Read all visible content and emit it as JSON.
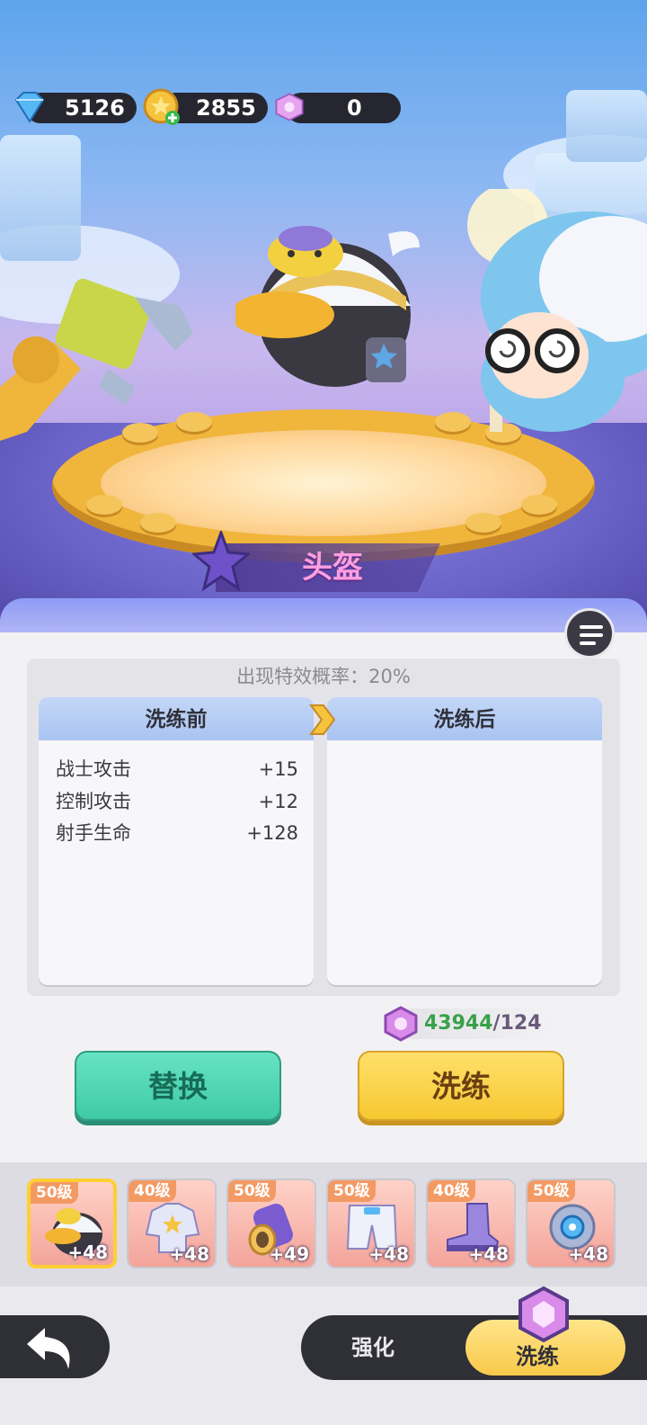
{
  "resources": {
    "gems": "5126",
    "gold": "2855",
    "crystal": "0"
  },
  "item_name": "头盔",
  "refine": {
    "effect_probability": "出现特效概率：20%",
    "before_title": "洗练前",
    "after_title": "洗练后",
    "before_stats": [
      {
        "name": "战士攻击",
        "value": "+15"
      },
      {
        "name": "控制攻击",
        "value": "+12"
      },
      {
        "name": "射手生命",
        "value": "+128"
      }
    ],
    "cost_have": "43944",
    "cost_need": "/124",
    "replace_label": "替换",
    "refine_label": "洗练"
  },
  "equipment": [
    {
      "level": "50级",
      "bonus": "+48",
      "icon": "helmet-icon"
    },
    {
      "level": "40级",
      "bonus": "+48",
      "icon": "armor-icon"
    },
    {
      "level": "50级",
      "bonus": "+49",
      "icon": "gauntlet-icon"
    },
    {
      "level": "50级",
      "bonus": "+48",
      "icon": "pants-icon"
    },
    {
      "level": "40级",
      "bonus": "+48",
      "icon": "boots-icon"
    },
    {
      "level": "50级",
      "bonus": "+48",
      "icon": "ring-icon"
    }
  ],
  "nav": {
    "strengthen_label": "强化",
    "refine_label": "洗练"
  },
  "colors": {
    "replace_button": "#4fd6b4",
    "refine_button": "#f8cf3d",
    "selected_slot_border": "#ffcf33",
    "cost_have_text": "#3aa14a"
  }
}
